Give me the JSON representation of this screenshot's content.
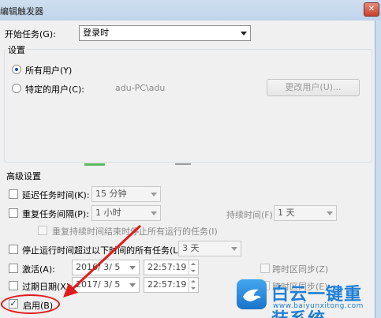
{
  "dialog": {
    "title": "编辑触发器",
    "close_glyph": "✕"
  },
  "start_task": {
    "label": "开始任务(G):",
    "value": "登录时"
  },
  "settings": {
    "group_label": "设置",
    "all_users": "所有用户(Y)",
    "specific_user": "特定的用户(C):",
    "user_account": "adu-PC\\adu",
    "change_user_button": "更改用户(U)..."
  },
  "advanced": {
    "group_label": "高级设置",
    "delay": {
      "label": "延迟任务时间(K):",
      "value": "15 分钟"
    },
    "repeat": {
      "label": "重复任务间隔(P):",
      "value": "1 小时",
      "duration_label": "持续时间(F):",
      "duration_value": "1 天",
      "stop_all_label": "重复持续时间结束时停止所有运行的任务(I)"
    },
    "stop_if_longer": {
      "label": "停止运行时间超过以下时间的所有任务(L):",
      "value": "3 天"
    },
    "activate": {
      "label": "激活(A):",
      "date": "2016/ 3/ 5",
      "time": "22:57:19",
      "sync_label": "跨时区同步(Z)"
    },
    "expire": {
      "label": "过期日期(X):",
      "date": "2017/ 3/ 5",
      "time": "22:57:19",
      "sync_label": "跨时区同步(E)"
    },
    "enabled": {
      "label": "启用(B)",
      "checked_glyph": "✓"
    }
  },
  "watermark": {
    "cn_text": "白云一键重装系统",
    "url": "www.baiyunxitong.com",
    "logo_icon": "bird-icon"
  },
  "colors": {
    "annotation": "#e01b1b",
    "watermark": "#1e7fd6"
  }
}
